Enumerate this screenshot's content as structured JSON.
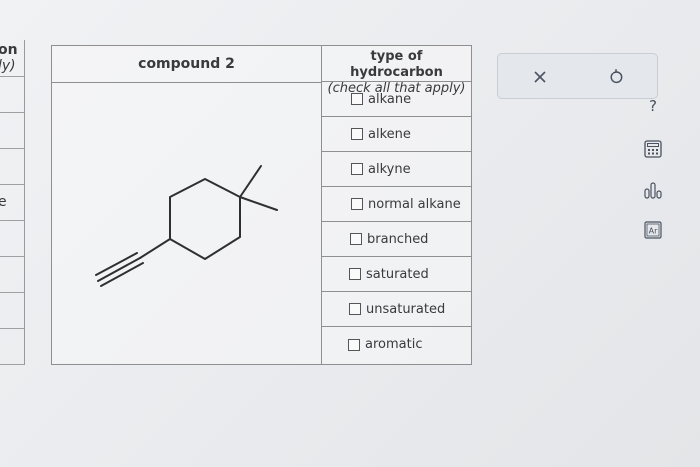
{
  "left_column": {
    "line1": "on",
    "line2": "ly)",
    "line3": "e"
  },
  "table": {
    "compound_header": "compound 2",
    "type_header_line1": "type of hydrocarbon",
    "type_header_line2": "(check all that apply)",
    "options": [
      {
        "label": "alkane",
        "checked": false
      },
      {
        "label": "alkene",
        "checked": false
      },
      {
        "label": "alkyne",
        "checked": false
      },
      {
        "label": "normal alkane",
        "checked": false
      },
      {
        "label": "branched",
        "checked": false
      },
      {
        "label": "saturated",
        "checked": false
      },
      {
        "label": "unsaturated",
        "checked": false
      },
      {
        "label": "aromatic",
        "checked": false
      }
    ]
  },
  "tools": {
    "close_icon": "close-icon",
    "undo_icon": "undo-icon",
    "help_icon": "help-icon",
    "help_label": "?",
    "calculator_icon": "calculator-icon",
    "chart_icon": "bar-chart-icon",
    "periodic_icon": "periodic-table-icon",
    "periodic_label": "Ar"
  },
  "colors": {
    "icon_stroke": "#4a5260",
    "line": "#8f8f8f"
  }
}
